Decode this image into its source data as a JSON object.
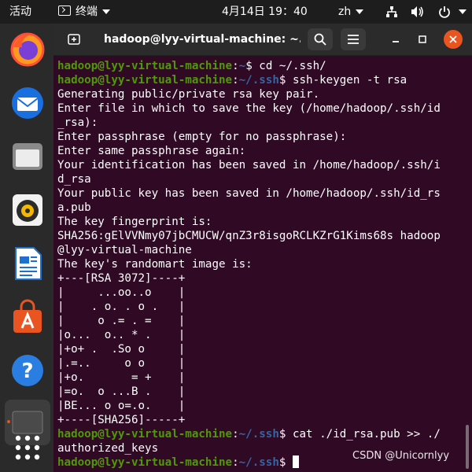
{
  "topbar": {
    "activities": "活动",
    "app_name": "终端",
    "clock": "4月14日  19：40",
    "input_method": "zh"
  },
  "dock": {
    "apps": [
      "firefox",
      "thunderbird",
      "files",
      "rhythmbox",
      "libreoffice-writer",
      "ubuntu-software",
      "help",
      "terminal",
      "show-applications"
    ]
  },
  "window": {
    "title": "hadoop@lyy-virtual-machine: ~..."
  },
  "terminal": {
    "user_host": "hadoop@lyy-virtual-machine",
    "lines": [
      {
        "type": "prompt",
        "path": "~",
        "cmd": " cd ~/.ssh/"
      },
      {
        "type": "prompt",
        "path": "~/.ssh",
        "cmd": " ssh-keygen -t rsa"
      },
      {
        "type": "text",
        "text": "Generating public/private rsa key pair."
      },
      {
        "type": "text",
        "text": "Enter file in which to save the key (/home/hadoop/.ssh/id"
      },
      {
        "type": "text",
        "text": "_rsa):"
      },
      {
        "type": "text",
        "text": "Enter passphrase (empty for no passphrase):"
      },
      {
        "type": "text",
        "text": "Enter same passphrase again:"
      },
      {
        "type": "text",
        "text": "Your identification has been saved in /home/hadoop/.ssh/i"
      },
      {
        "type": "text",
        "text": "d_rsa"
      },
      {
        "type": "text",
        "text": "Your public key has been saved in /home/hadoop/.ssh/id_rs"
      },
      {
        "type": "text",
        "text": "a.pub"
      },
      {
        "type": "text",
        "text": "The key fingerprint is:"
      },
      {
        "type": "text",
        "text": "SHA256:gElVVNmy07jbCMUCW/qnZ3r8isgoRCLKZrG1Kims68s hadoop"
      },
      {
        "type": "text",
        "text": "@lyy-virtual-machine"
      },
      {
        "type": "text",
        "text": "The key's randomart image is:"
      },
      {
        "type": "text",
        "text": "+---[RSA 3072]----+"
      },
      {
        "type": "text",
        "text": "|     ...oo..o    |"
      },
      {
        "type": "text",
        "text": "|    . o. . o .   |"
      },
      {
        "type": "text",
        "text": "|     o .= . =    |"
      },
      {
        "type": "text",
        "text": "|o...  o.. * .    |"
      },
      {
        "type": "text",
        "text": "|+o+ .  .So o     |"
      },
      {
        "type": "text",
        "text": "|.=..     o o     |"
      },
      {
        "type": "text",
        "text": "|+o.       = +    |"
      },
      {
        "type": "text",
        "text": "|=o.  o ...B .    |"
      },
      {
        "type": "text",
        "text": "|BE... o o=.o.    |"
      },
      {
        "type": "text",
        "text": "+----[SHA256]-----+"
      },
      {
        "type": "prompt",
        "path": "~/.ssh",
        "cmd": " cat ./id_rsa.pub >> ./"
      },
      {
        "type": "text",
        "text": "authorized_keys"
      },
      {
        "type": "prompt",
        "path": "~/.ssh",
        "cmd": " ",
        "cursor": true
      }
    ]
  },
  "watermark": "CSDN @Unicornlyy",
  "colors": {
    "terminal_bg": "#300a24",
    "prompt_user": "#4e9a06",
    "prompt_path": "#3465a4",
    "accent": "#e95420"
  }
}
